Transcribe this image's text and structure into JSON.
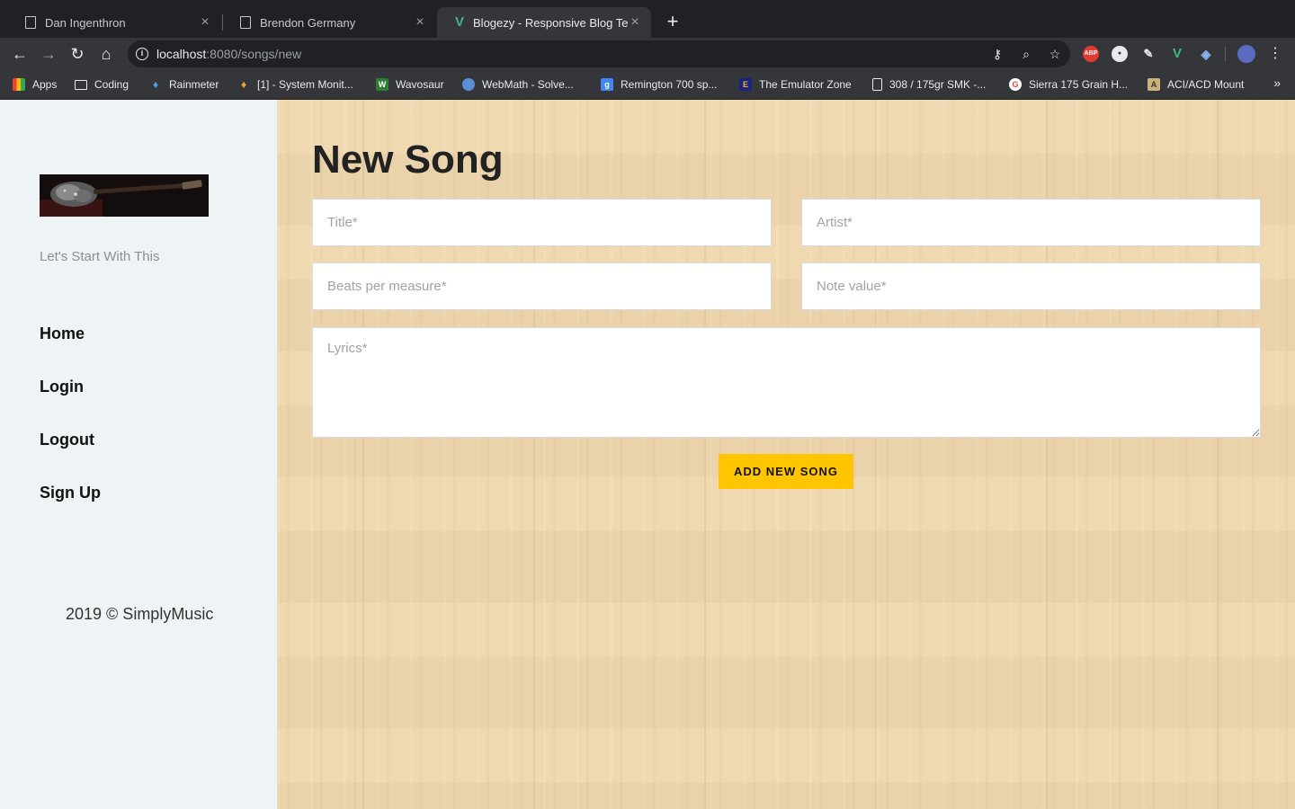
{
  "browser": {
    "tabs": [
      {
        "title": "Dan Ingenthron",
        "icon": "document-icon"
      },
      {
        "title": "Brendon Germany",
        "icon": "document-icon"
      },
      {
        "title": "Blogezy - Responsive Blog Template",
        "icon": "vue-icon",
        "active": true
      }
    ],
    "url_host": "localhost",
    "url_path": ":8080/songs/new",
    "bookmarks": [
      {
        "label": "Apps",
        "icon": "apps-grid-icon",
        "color": "#e8453c"
      },
      {
        "label": "Coding",
        "icon": "folder-icon",
        "color": "#9aa0a6"
      },
      {
        "label": "Rainmeter",
        "icon": "rainmeter-icon",
        "color": "#4f9fe3"
      },
      {
        "label": "[1] - System Monit...",
        "icon": "drop-icon",
        "color": "#f2a33a"
      },
      {
        "label": "Wavosaur",
        "icon": "wavosaur-icon",
        "color": "#2e7d32"
      },
      {
        "label": "WebMath - Solve...",
        "icon": "globe-icon",
        "color": "#5a8fd6"
      },
      {
        "label": "Remington 700 sp...",
        "icon": "google-g-icon",
        "color": "#4285f4"
      },
      {
        "label": "The Emulator Zone",
        "icon": "emulator-icon",
        "color": "#f4c20d"
      },
      {
        "label": "308 / 175gr SMK -...",
        "icon": "document-icon",
        "color": "#9aa0a6"
      },
      {
        "label": "Sierra 175 Grain H...",
        "icon": "google-icon",
        "color": "#ffffff"
      },
      {
        "label": "ACI/ACD Mount",
        "icon": "aci-icon",
        "color": "#c9b27c"
      }
    ]
  },
  "sidebar": {
    "tagline": "Let's Start With This",
    "nav": [
      {
        "label": "Home"
      },
      {
        "label": "Login"
      },
      {
        "label": "Logout"
      },
      {
        "label": "Sign Up"
      }
    ],
    "footer": "2019 © SimplyMusic"
  },
  "form": {
    "title": "New Song",
    "title_placeholder": "Title*",
    "artist_placeholder": "Artist*",
    "beats_placeholder": "Beats per measure*",
    "note_placeholder": "Note value*",
    "lyrics_placeholder": "Lyrics*",
    "submit_label": "ADD NEW SONG"
  },
  "colors": {
    "accent": "#ffc600",
    "sidebar_bg": "#eef3f6",
    "wood_bg": "#efd6ad"
  }
}
